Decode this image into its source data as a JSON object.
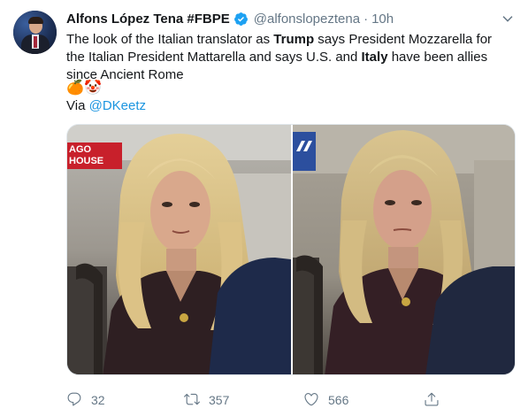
{
  "tweet": {
    "author_name": "Alfons López Tena #FBPE",
    "handle": "@alfonslopeztena",
    "separator": "·",
    "time": "10h",
    "text_parts": [
      {
        "text": "The look of the Italian translator as ",
        "bold": false
      },
      {
        "text": "Trump",
        "bold": true
      },
      {
        "text": " says President Mozzarella for the Italian President Mattarella and says U.S. and ",
        "bold": false
      },
      {
        "text": "Italy",
        "bold": true
      },
      {
        "text": " have been allies since Ancient Rome",
        "bold": false
      }
    ],
    "emojis": [
      "🍊",
      "🤡"
    ],
    "via_label": "Via",
    "via_mention": "@DKeetz"
  },
  "media": {
    "left_photo_overlay_line1": "AGO",
    "left_photo_overlay_line2": "HOUSE",
    "colors": {
      "banner_red": "#c8202b",
      "banner_blue": "#2c4f9e"
    }
  },
  "actions": {
    "reply_count": "32",
    "retweet_count": "357",
    "like_count": "566"
  },
  "icons": {
    "verified": "verified-badge-icon",
    "caret": "chevron-down-icon",
    "reply": "reply-icon",
    "retweet": "retweet-icon",
    "like": "heart-icon",
    "share": "share-icon"
  },
  "colors": {
    "link": "#1b95e0",
    "muted": "#657786",
    "text": "#14171a"
  }
}
